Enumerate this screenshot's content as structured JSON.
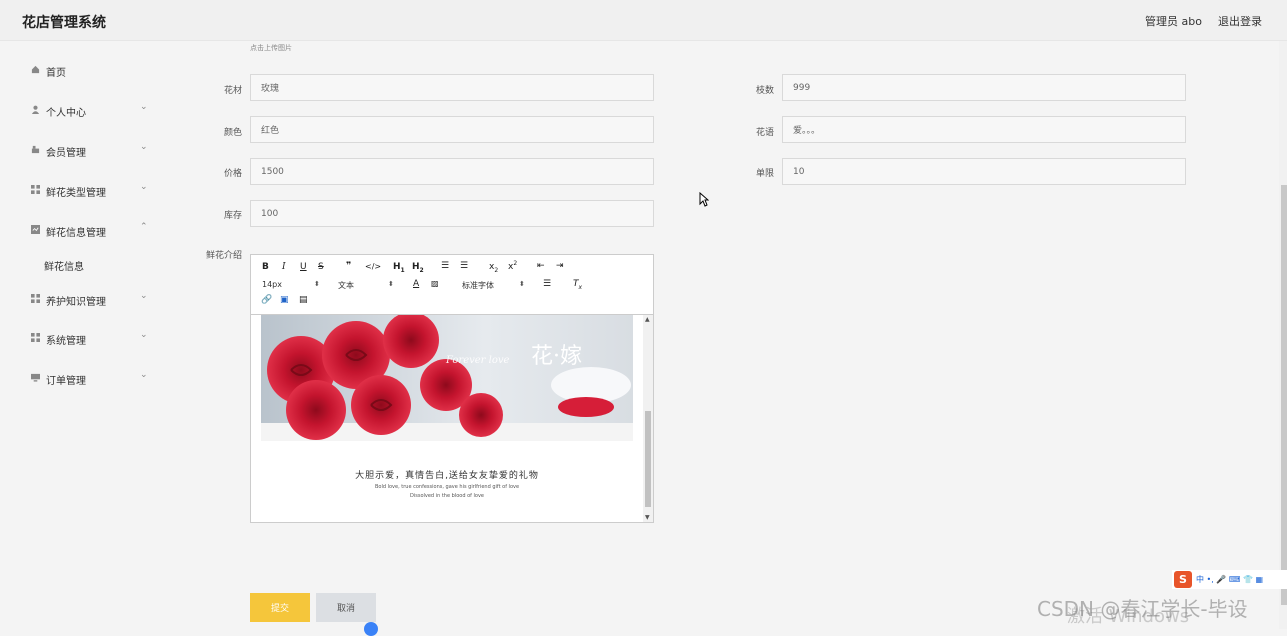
{
  "header": {
    "brand": "花店管理系统",
    "user_label": "管理员 abo",
    "logout_label": "退出登录"
  },
  "sidebar": {
    "items": [
      {
        "label": "首页",
        "icon": "home-icon"
      },
      {
        "label": "个人中心",
        "icon": "user-icon"
      },
      {
        "label": "会员管理",
        "icon": "member-icon"
      },
      {
        "label": "鲜花类型管理",
        "icon": "grid-icon"
      },
      {
        "label": "鲜花信息管理",
        "icon": "doc-icon"
      },
      {
        "label": "养护知识管理",
        "icon": "grid-icon"
      },
      {
        "label": "系统管理",
        "icon": "grid-icon"
      },
      {
        "label": "订单管理",
        "icon": "monitor-icon"
      }
    ],
    "subitem": "鲜花信息"
  },
  "form": {
    "upload_hint": "点击上传图片",
    "fields": {
      "material": {
        "label": "花材",
        "value": "玫瑰"
      },
      "count": {
        "label": "枝数",
        "value": "999"
      },
      "color": {
        "label": "颜色",
        "value": "红色"
      },
      "language": {
        "label": "花语",
        "value": "爱。。。"
      },
      "price": {
        "label": "价格",
        "value": "1500"
      },
      "limit": {
        "label": "单限",
        "value": "10"
      },
      "stock": {
        "label": "库存",
        "value": "100"
      }
    },
    "intro_label": "鲜花介绍"
  },
  "editor": {
    "font_size": "14px",
    "block_format": "文本",
    "font_family": "标准字体",
    "banner_script": "Forever love",
    "banner_title": "花·嫁",
    "caption_cn": "大胆示爱，真情告白,送给女友挚爱的礼物",
    "caption_en1": "Bold love, true confessions, gave his girlfriend gift of love",
    "caption_en2": "Dissolved in the blood of love"
  },
  "buttons": {
    "submit": "提交",
    "cancel": "取消"
  },
  "overlay": {
    "csdn": "CSDN @春江学长-毕设",
    "windows": "激活 Windows",
    "ime_logo": "S",
    "ime_text": "中 •, 🎤 ⌨ 👕 ▦"
  },
  "colors": {
    "submit_bg": "#f5c63b",
    "cancel_bg": "#dcdfe3",
    "ime_accent": "#e8552a"
  }
}
